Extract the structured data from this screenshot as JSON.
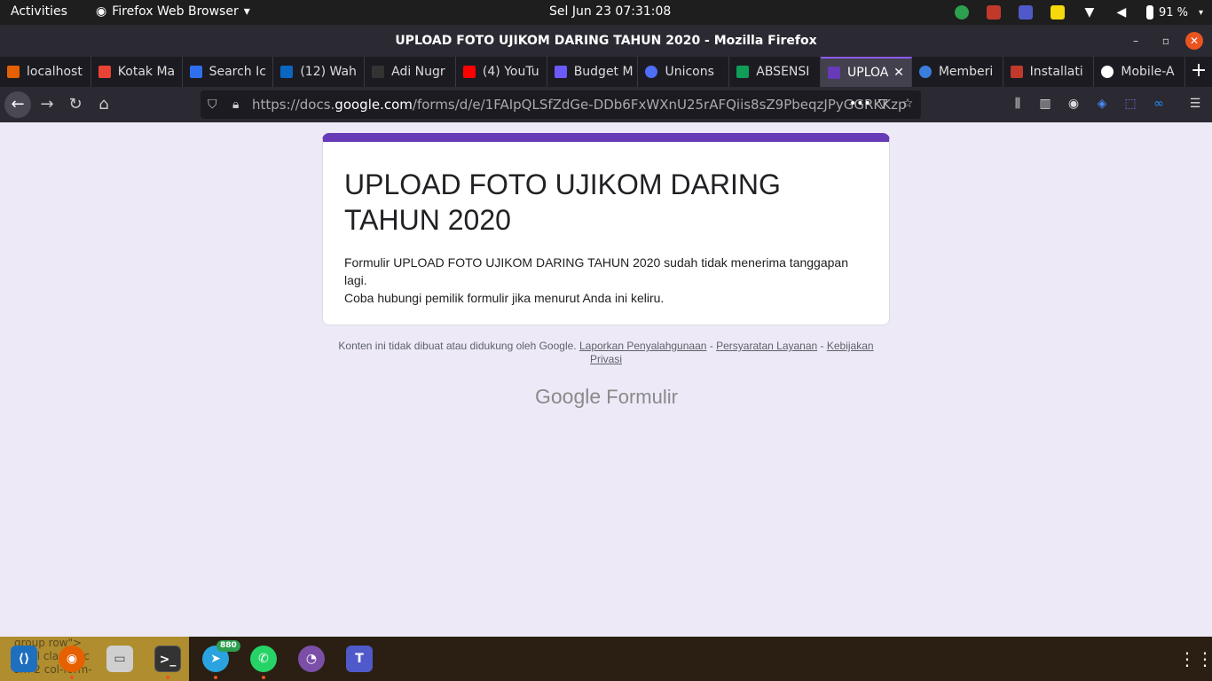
{
  "system": {
    "activities": "Activities",
    "app_menu": "Firefox Web Browser",
    "clock": "Sel Jun 23  07:31:08",
    "battery": "91 %",
    "indicator_badge": "880"
  },
  "window": {
    "title": "UPLOAD FOTO UJIKOM DARING TAHUN 2020 - Mozilla Firefox"
  },
  "tabs": [
    {
      "label": "localhost",
      "color": "#e66000"
    },
    {
      "label": "Kotak Ma",
      "color": "#ea4335"
    },
    {
      "label": "Search Ic",
      "color": "#2f6fed"
    },
    {
      "label": "(12) Wah",
      "color": "#0a66c2"
    },
    {
      "label": "Adi Nugr",
      "color": "#333333"
    },
    {
      "label": "(4) YouTu",
      "color": "#ff0000"
    },
    {
      "label": "Budget M",
      "color": "#6a5af9"
    },
    {
      "label": "Unicons",
      "color": "#4f6ef7"
    },
    {
      "label": "ABSENSI",
      "color": "#0f9d58"
    },
    {
      "label": "UPLOA",
      "color": "#673ab7"
    },
    {
      "label": "Memberi",
      "color": "#3b7ddd"
    },
    {
      "label": "Installati",
      "color": "#c0392b"
    },
    {
      "label": "Mobile-A",
      "color": "#ffffff"
    }
  ],
  "url": {
    "prefix": "https://docs.",
    "domain": "google.com",
    "path": "/forms/d/e/1FAIpQLSfZdGe-DDb6FxWXnU25rAFQiis8sZ9PbeqzJPyGGRKKzp"
  },
  "form": {
    "title": "UPLOAD FOTO UJIKOM DARING TAHUN 2020",
    "message_line1": "Formulir UPLOAD FOTO UJIKOM DARING TAHUN 2020 sudah tidak menerima tanggapan lagi.",
    "message_line2": "Coba hubungi pemilik formulir jika menurut Anda ini keliru."
  },
  "footer": {
    "disclaimer": "Konten ini tidak dibuat atau didukung oleh Google.",
    "report_abuse": "Laporkan Penyalahgunaan",
    "terms": "Persyaratan Layanan",
    "privacy": "Kebijakan Privasi",
    "separator": " - ",
    "brand_google": "Google",
    "brand_forms": "Formulir"
  },
  "dock": {
    "preview_text": "group row\">\nlabel class=\"c\nsm-2 col-form-",
    "telegram_badge": "880"
  }
}
